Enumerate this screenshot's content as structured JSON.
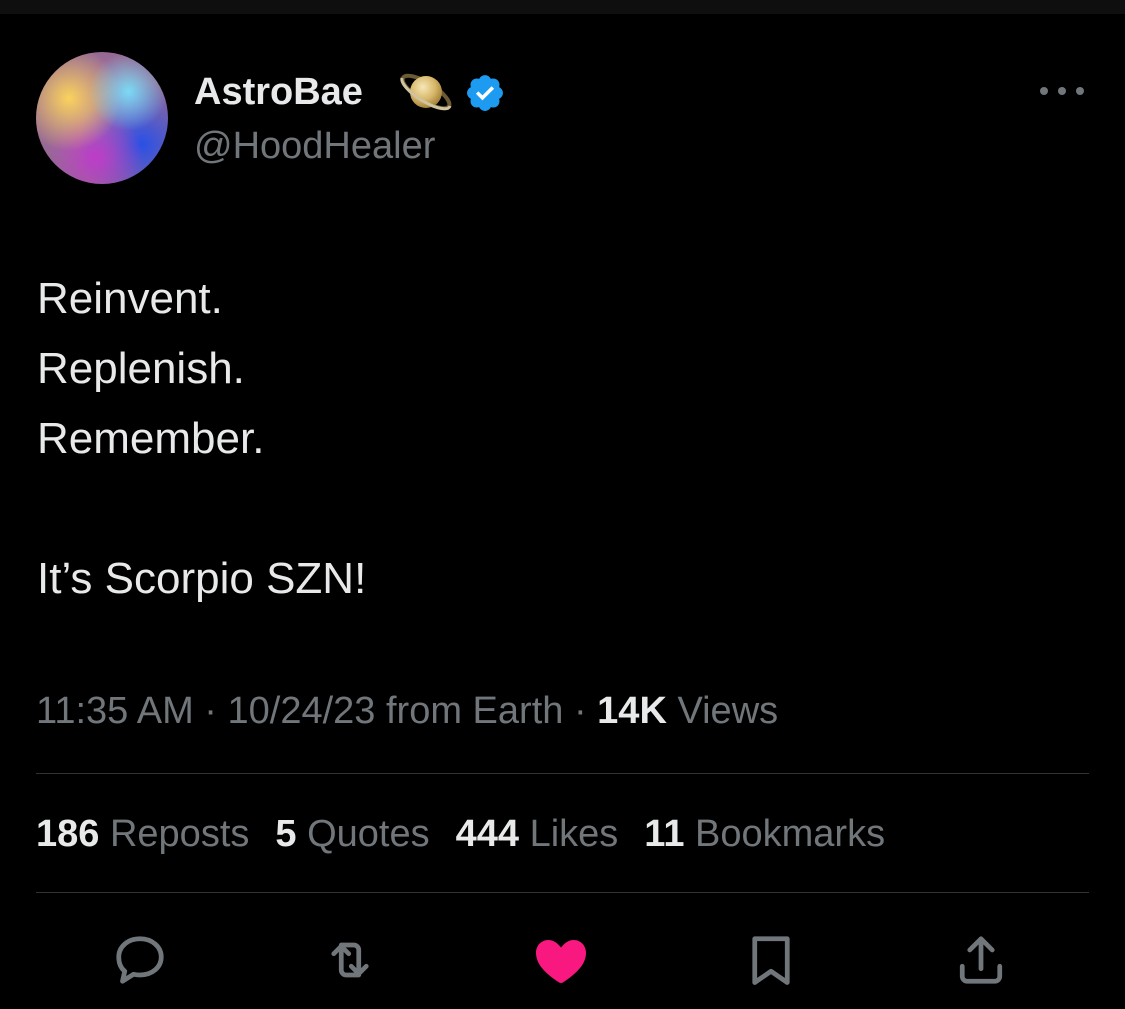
{
  "author": {
    "display_name": "AstroBae",
    "handle": "@HoodHealer",
    "verified": true,
    "emoji_icon": "saturn-icon"
  },
  "tweet": {
    "lines": [
      "Reinvent.",
      "Replenish.",
      "Remember.",
      "",
      "It’s Scorpio SZN!"
    ]
  },
  "meta": {
    "time": "11:35 AM",
    "sep1": "·",
    "date": "10/24/23",
    "source": "from Earth",
    "sep2": "·",
    "views_count": "14K",
    "views_label": "Views"
  },
  "stats": {
    "reposts_count": "186",
    "reposts_label": "Reposts",
    "quotes_count": "5",
    "quotes_label": "Quotes",
    "likes_count": "444",
    "likes_label": "Likes",
    "bookmarks_count": "11",
    "bookmarks_label": "Bookmarks"
  },
  "actions": [
    "reply-icon",
    "repost-icon",
    "like-icon",
    "bookmark-icon",
    "share-icon"
  ],
  "colors": {
    "background": "#000000",
    "primary_text": "#e7e9ea",
    "secondary_text": "#71767b",
    "verified_blue": "#1d9bf0",
    "like_pink": "#f91880",
    "divider": "#2f3336"
  }
}
